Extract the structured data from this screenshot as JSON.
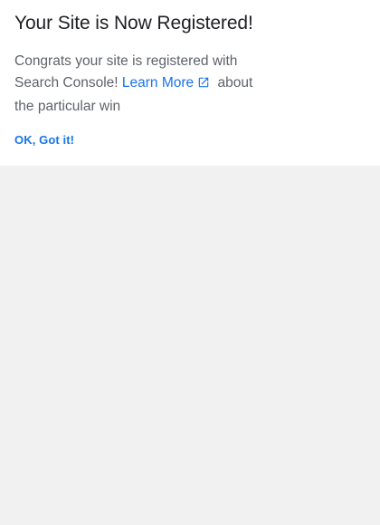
{
  "dialog": {
    "title": "Your Site is Now Registered!",
    "message_before_link": "Congrats your site is registered with Search Console! ",
    "link_label": "Learn More",
    "link_icon": "external-link-icon",
    "message_after_link": " about the particular win",
    "confirm_label": "OK, Got it!"
  },
  "colors": {
    "accent": "#1a73e8",
    "title_text": "#202124",
    "body_text": "#5f6368",
    "card_background": "#ffffff",
    "page_background": "#f1f1f1"
  }
}
